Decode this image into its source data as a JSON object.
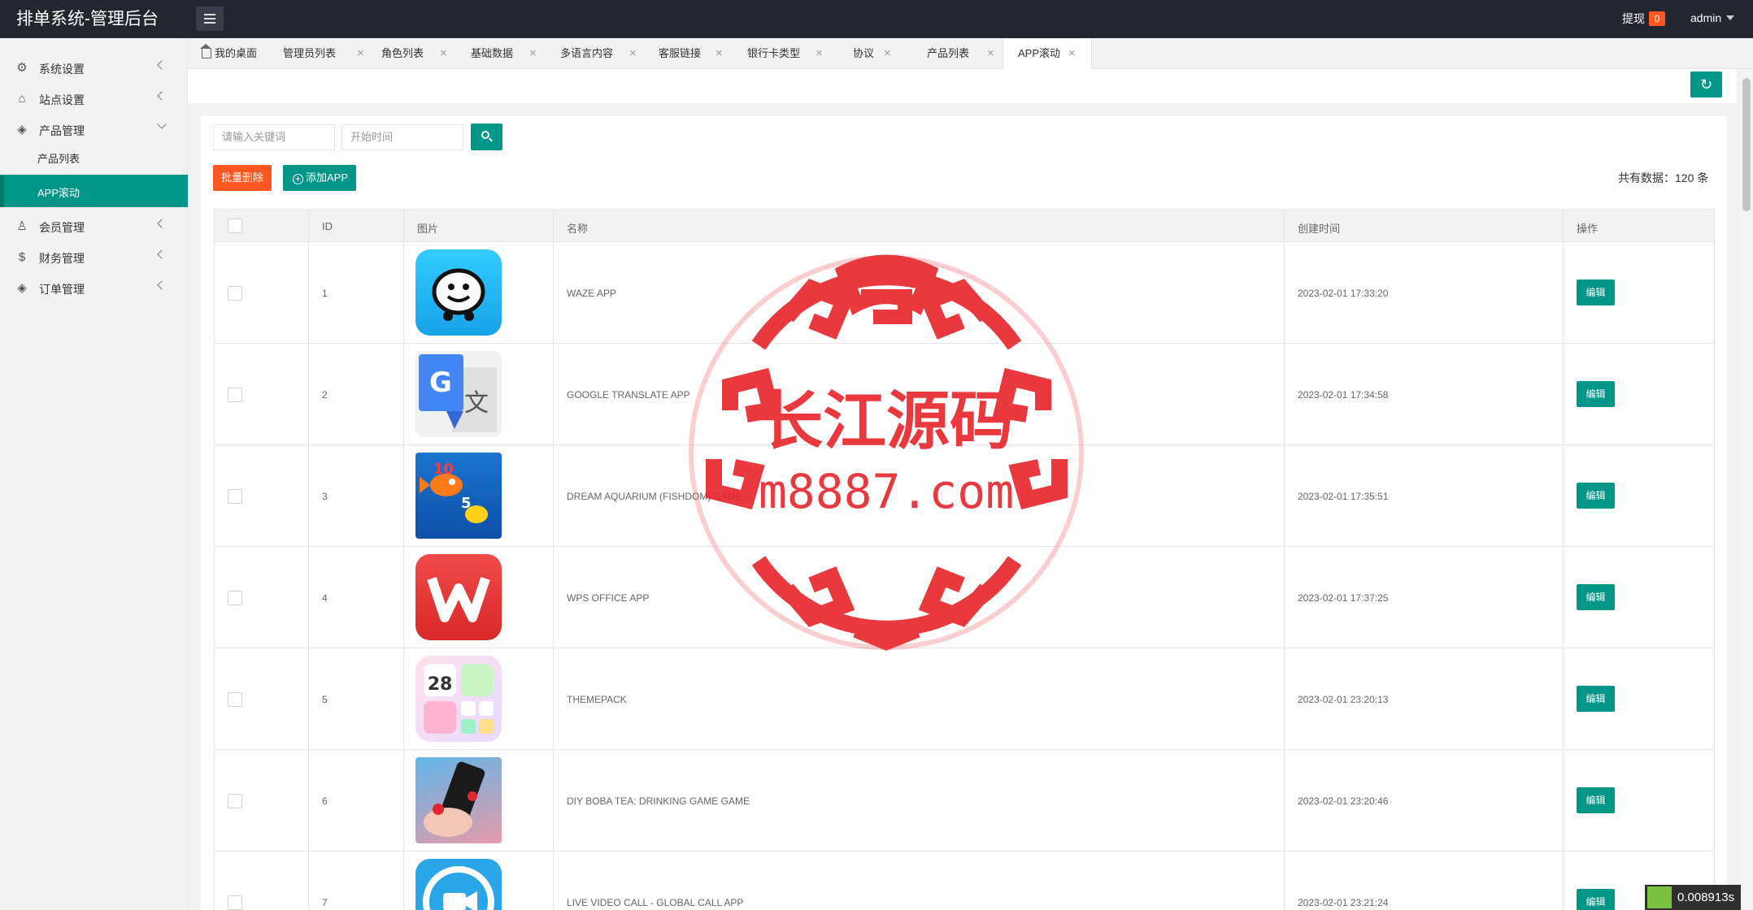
{
  "header": {
    "title": "排单系统-管理后台",
    "withdraw_label": "提现",
    "withdraw_count": "0",
    "user": "admin"
  },
  "sidebar": {
    "items": [
      {
        "label": "系统设置",
        "icon": "gear-icon"
      },
      {
        "label": "站点设置",
        "icon": "home-icon"
      },
      {
        "label": "产品管理",
        "icon": "cube-icon"
      },
      {
        "label": "产品列表",
        "sub": true
      },
      {
        "label": "APP滚动",
        "sub": true,
        "active": true
      },
      {
        "label": "会员管理",
        "icon": "user-icon"
      },
      {
        "label": "财务管理",
        "icon": "dollar-icon"
      },
      {
        "label": "订单管理",
        "icon": "package-icon"
      }
    ]
  },
  "tabs": [
    {
      "label": "我的桌面"
    },
    {
      "label": "管理员列表"
    },
    {
      "label": "角色列表"
    },
    {
      "label": "基础数据"
    },
    {
      "label": "多语言内容"
    },
    {
      "label": "客服链接"
    },
    {
      "label": "银行卡类型"
    },
    {
      "label": "协议"
    },
    {
      "label": "产品列表"
    },
    {
      "label": "APP滚动",
      "active": true
    }
  ],
  "toolbar": {
    "keyword_placeholder": "请输入关键词",
    "start_time_placeholder": "开始时间",
    "batch_delete_label": "批量删除",
    "add_app_label": "添加APP",
    "total_label": "共有数据：120 条"
  },
  "table": {
    "headers": {
      "id": "ID",
      "image": "图片",
      "name": "名称",
      "created": "创建时间",
      "action": "操作"
    },
    "edit_label": "编辑",
    "rows": [
      {
        "id": "1",
        "name": "WAZE APP",
        "created": "2023-02-01 17:33:20",
        "icon": "waze-app-icon"
      },
      {
        "id": "2",
        "name": "GOOGLE TRANSLATE APP",
        "created": "2023-02-01 17:34:58",
        "icon": "google-translate-icon"
      },
      {
        "id": "3",
        "name": "DREAM AQUARIUM (FISHDOM) GAME",
        "created": "2023-02-01 17:35:51",
        "icon": "fishdom-icon"
      },
      {
        "id": "4",
        "name": "WPS OFFICE APP",
        "created": "2023-02-01 17:37:25",
        "icon": "wps-office-icon"
      },
      {
        "id": "5",
        "name": "THEMEPACK",
        "created": "2023-02-01 23:20:13",
        "icon": "themepack-icon"
      },
      {
        "id": "6",
        "name": "DIY BOBA TEA: DRINKING GAME GAME",
        "created": "2023-02-01 23:20:46",
        "icon": "boba-tea-icon"
      },
      {
        "id": "7",
        "name": "LIVE VIDEO CALL - GLOBAL CALL APP",
        "created": "2023-02-01 23:21:24",
        "icon": "video-call-icon"
      }
    ]
  },
  "watermark": {
    "text_cn": "长江源码",
    "text_url": "m8887.com"
  },
  "footer": {
    "timer": "0.008913s"
  }
}
